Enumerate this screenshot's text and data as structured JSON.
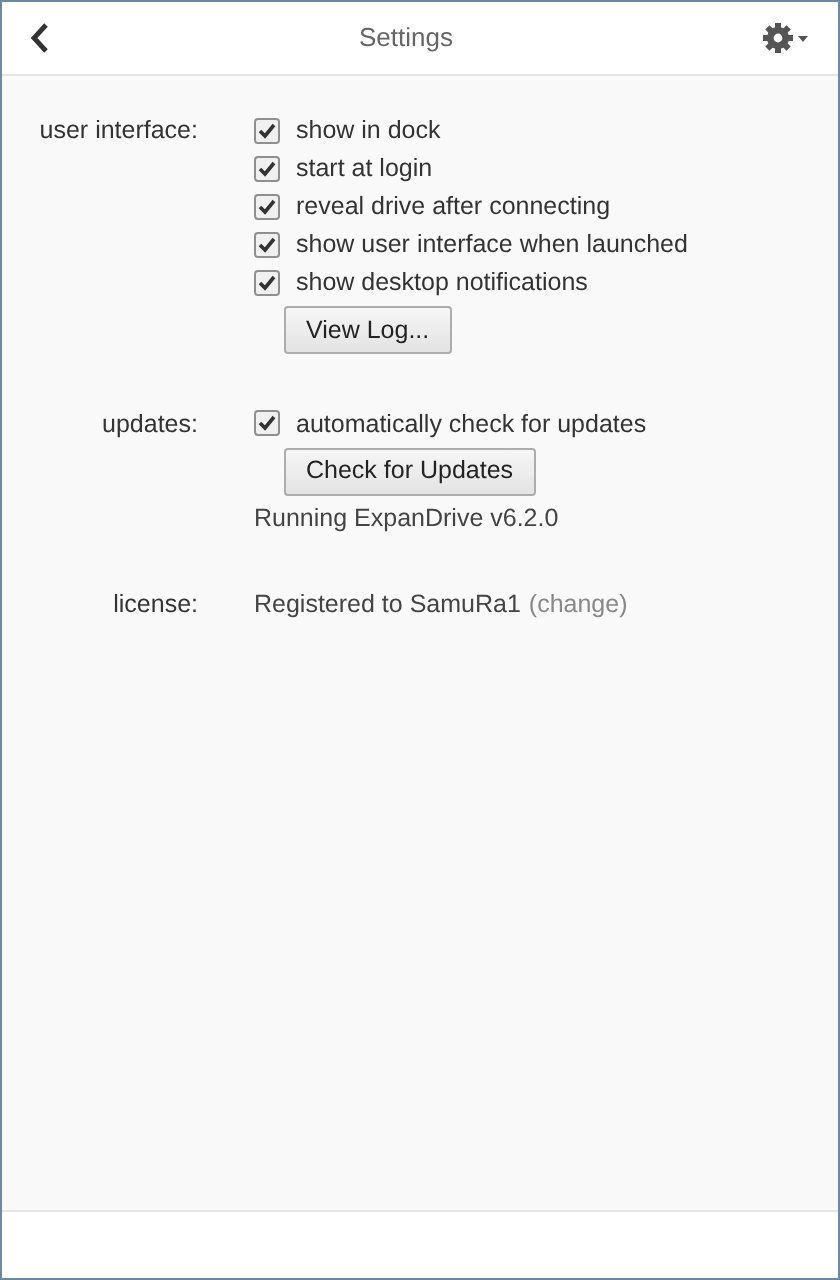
{
  "header": {
    "title": "Settings"
  },
  "sections": [
    {
      "label": "user interface:",
      "items": [
        {
          "kind": "checkbox",
          "label": "show in dock",
          "checked": true
        },
        {
          "kind": "checkbox",
          "label": "start at login",
          "checked": true
        },
        {
          "kind": "checkbox",
          "label": "reveal drive after connecting",
          "checked": true
        },
        {
          "kind": "checkbox",
          "label": "show user interface when launched",
          "checked": true
        },
        {
          "kind": "checkbox",
          "label": "show desktop notifications",
          "checked": true
        },
        {
          "kind": "button",
          "label": "View Log..."
        }
      ]
    },
    {
      "label": "updates:",
      "items": [
        {
          "kind": "checkbox",
          "label": "automatically check for updates",
          "checked": true
        },
        {
          "kind": "button",
          "label": "Check for Updates"
        },
        {
          "kind": "text",
          "text": "Running ExpanDrive v6.2.0"
        }
      ]
    },
    {
      "label": "license:",
      "items": [
        {
          "kind": "license",
          "text": "Registered to SamuRa1",
          "link": "(change)"
        }
      ]
    }
  ]
}
